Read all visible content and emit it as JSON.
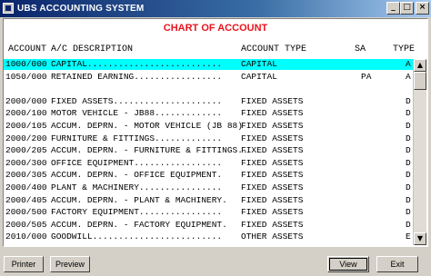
{
  "window": {
    "title": "UBS ACCOUNTING SYSTEM"
  },
  "report": {
    "title": "CHART OF ACCOUNT"
  },
  "columns": {
    "account": "ACCOUNT",
    "description": "A/C DESCRIPTION",
    "type": "ACCOUNT TYPE",
    "sa": "SA",
    "type_code": "TYPE"
  },
  "rows": [
    {
      "account": "1000/000",
      "desc": "CAPITAL..........................",
      "type": "CAPITAL",
      "sa": "",
      "code": "A",
      "selected": true
    },
    {
      "account": "1050/000",
      "desc": "RETAINED EARNING.................",
      "type": "CAPITAL",
      "sa": "PA",
      "code": "A"
    },
    {
      "account": "",
      "desc": "",
      "type": "",
      "sa": "",
      "code": ""
    },
    {
      "account": "2000/000",
      "desc": "FIXED ASSETS.....................",
      "type": "FIXED ASSETS",
      "sa": "",
      "code": "D"
    },
    {
      "account": "2000/100",
      "desc": "MOTOR VEHICLE - JB88.............",
      "type": "FIXED ASSETS",
      "sa": "",
      "code": "D"
    },
    {
      "account": "2000/105",
      "desc": "ACCUM. DEPRN. - MOTOR VEHICLE (JB 88)",
      "type": "FIXED ASSETS",
      "sa": "",
      "code": "D"
    },
    {
      "account": "2000/200",
      "desc": "FURNITURE & FITTINGS.............",
      "type": "FIXED ASSETS",
      "sa": "",
      "code": "D"
    },
    {
      "account": "2000/205",
      "desc": "ACCUM. DEPRN. - FURNITURE & FITTINGS..",
      "type": "FIXED ASSETS",
      "sa": "",
      "code": "D"
    },
    {
      "account": "2000/300",
      "desc": "OFFICE EQUIPMENT.................",
      "type": "FIXED ASSETS",
      "sa": "",
      "code": "D"
    },
    {
      "account": "2000/305",
      "desc": "ACCUM. DEPRN. - OFFICE EQUIPMENT.",
      "type": "FIXED ASSETS",
      "sa": "",
      "code": "D"
    },
    {
      "account": "2000/400",
      "desc": "PLANT & MACHINERY................",
      "type": "FIXED ASSETS",
      "sa": "",
      "code": "D"
    },
    {
      "account": "2000/405",
      "desc": "ACCUM. DEPRN. - PLANT & MACHINERY.",
      "type": "FIXED ASSETS",
      "sa": "",
      "code": "D"
    },
    {
      "account": "2000/500",
      "desc": "FACTORY EQUIPMENT................",
      "type": "FIXED ASSETS",
      "sa": "",
      "code": "D"
    },
    {
      "account": "2000/505",
      "desc": "ACCUM. DEPRN. - FACTORY EQUIPMENT.",
      "type": "FIXED ASSETS",
      "sa": "",
      "code": "D"
    },
    {
      "account": "2010/000",
      "desc": "GOODWILL.........................",
      "type": "OTHER ASSETS",
      "sa": "",
      "code": "E"
    }
  ],
  "buttons": {
    "printer": "Printer",
    "preview": "Preview",
    "view": "View",
    "exit": "Exit"
  },
  "window_controls": {
    "minimize": "_",
    "maximize": "□",
    "close": "×"
  },
  "scrollbar": {
    "up": "▲",
    "down": "▼"
  }
}
